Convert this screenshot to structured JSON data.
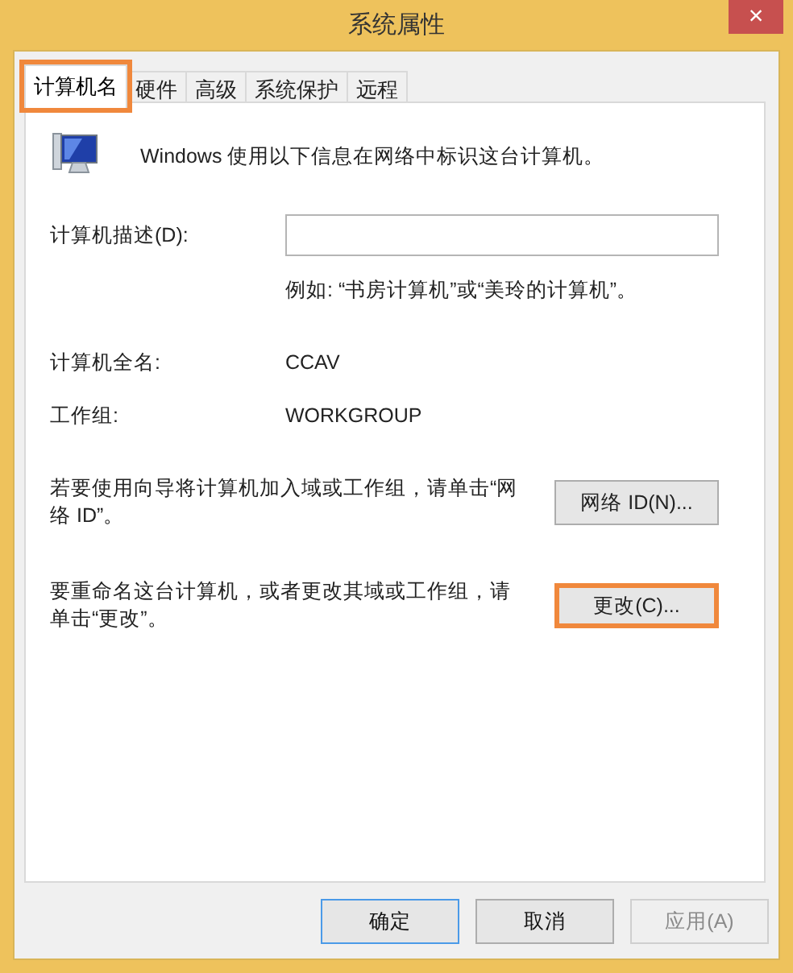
{
  "window": {
    "title": "系统属性",
    "close": "×"
  },
  "tabs": [
    {
      "label": "计算机名",
      "selected": true,
      "highlighted": true
    },
    {
      "label": "硬件",
      "selected": false,
      "highlighted": false
    },
    {
      "label": "高级",
      "selected": false,
      "highlighted": false
    },
    {
      "label": "系统保护",
      "selected": false,
      "highlighted": false
    },
    {
      "label": "远程",
      "selected": false,
      "highlighted": false
    }
  ],
  "intro": "Windows 使用以下信息在网络中标识这台计算机。",
  "description": {
    "label": "计算机描述(D):",
    "hint": "例如: “书房计算机”或“美玲的计算机”。"
  },
  "fields": [
    {
      "label": "计算机全名:",
      "value": "CCAV"
    },
    {
      "label": "工作组:",
      "value": "WORKGROUP"
    }
  ],
  "actions": [
    {
      "text": "若要使用向导将计算机加入域或工作组，请单击“网络 ID”。",
      "button": "网络 ID(N)...",
      "highlighted": false
    },
    {
      "text": "要重命名这台计算机，或者更改其域或工作组，请单击“更改”。",
      "button": "更改(C)...",
      "highlighted": true
    }
  ],
  "buttons": [
    {
      "label": "确定",
      "default": true,
      "disabled": false
    },
    {
      "label": "取消",
      "default": false,
      "disabled": false
    },
    {
      "label": "应用(A)",
      "default": false,
      "disabled": true
    }
  ]
}
